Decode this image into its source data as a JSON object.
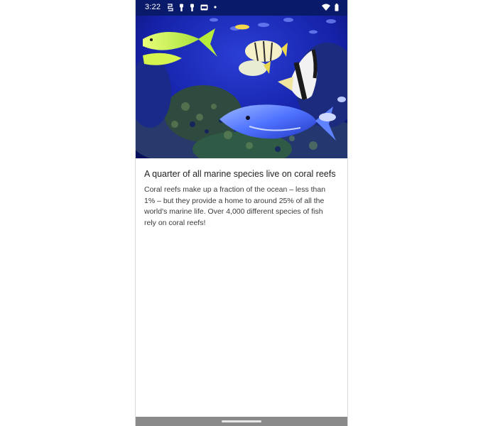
{
  "status_bar": {
    "time": "3:22",
    "left_icons": [
      "sync-icon",
      "notification-icon",
      "notification-icon",
      "sim-icon",
      "dot-icon"
    ],
    "right_icons": [
      "wifi-icon",
      "battery-icon"
    ]
  },
  "hero": {
    "subject": "coral-reef-fish-image"
  },
  "article": {
    "title": "A quarter of all marine species live on coral reefs",
    "body": " Coral reefs make up a fraction of the ocean – less than 1% – but they provide a home to around 25% of all the world's marine life. Over 4,000 different species of fish rely on coral reefs!"
  },
  "colors": {
    "status_bar": "#0a1a6a",
    "nav_bar": "#8a8a8a",
    "title_text": "#1f1f1f",
    "body_text": "#3a3a3a"
  }
}
